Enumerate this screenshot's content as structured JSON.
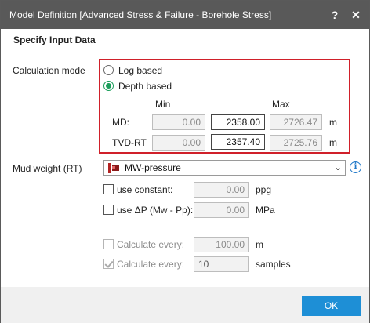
{
  "window": {
    "title": "Model Definition [Advanced Stress & Failure - Borehole Stress]",
    "help_glyph": "?",
    "close_glyph": "✕"
  },
  "section_title": "Specify Input Data",
  "calculation_mode": {
    "label": "Calculation mode",
    "options": [
      "Log based",
      "Depth based"
    ],
    "selected": "Depth based"
  },
  "range": {
    "min_header": "Min",
    "max_header": "Max",
    "rows": [
      {
        "label": "MD:",
        "min": "0.00",
        "value": "2358.00",
        "max": "2726.47",
        "unit": "m"
      },
      {
        "label": "TVD-RT",
        "min": "0.00",
        "value": "2357.40",
        "max": "2725.76",
        "unit": "m"
      }
    ]
  },
  "mud_weight": {
    "label": "Mud weight (RT)",
    "selected": "MW-pressure",
    "info_glyph": "i"
  },
  "use_constant": {
    "label": "use constant:",
    "value": "0.00",
    "unit": "ppg",
    "checked": false
  },
  "use_delta_p": {
    "label": "use ΔP (Mw - Pp):",
    "value": "0.00",
    "unit": "MPa",
    "checked": false
  },
  "calc_every_m": {
    "label": "Calculate every:",
    "value": "100.00",
    "unit": "m",
    "checked": false
  },
  "calc_every_samples": {
    "label": "Calculate every:",
    "value": "10",
    "unit": "samples",
    "checked": true
  },
  "ok_label": "OK",
  "colors": {
    "titlebar": "#595959",
    "highlight_border": "#d0202a",
    "radio_selected": "#1b9e5b",
    "ok_button": "#1e8fd6",
    "info_icon": "#1f78c8"
  }
}
